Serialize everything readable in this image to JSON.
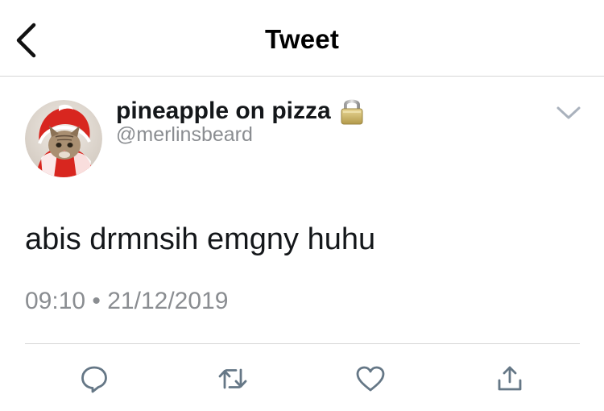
{
  "header": {
    "title": "Tweet",
    "back_icon": "chevron-left-icon"
  },
  "author": {
    "display_name": "pineapple on pizza",
    "handle": "@merlinsbeard",
    "protected_icon": "lock-icon",
    "avatar_subject": "cat in red hood",
    "menu_icon": "chevron-down-icon"
  },
  "tweet": {
    "text": "abis drmnsih emgny huhu",
    "timestamp": "09:10 • 21/12/2019"
  },
  "actions": {
    "reply_icon": "reply-icon",
    "retweet_icon": "retweet-icon",
    "like_icon": "heart-icon",
    "share_icon": "share-icon"
  },
  "colors": {
    "text": "#14171a",
    "muted": "#8a8d91",
    "icon": "#657786",
    "divider": "#d6d6d6",
    "background": "#ffffff"
  }
}
